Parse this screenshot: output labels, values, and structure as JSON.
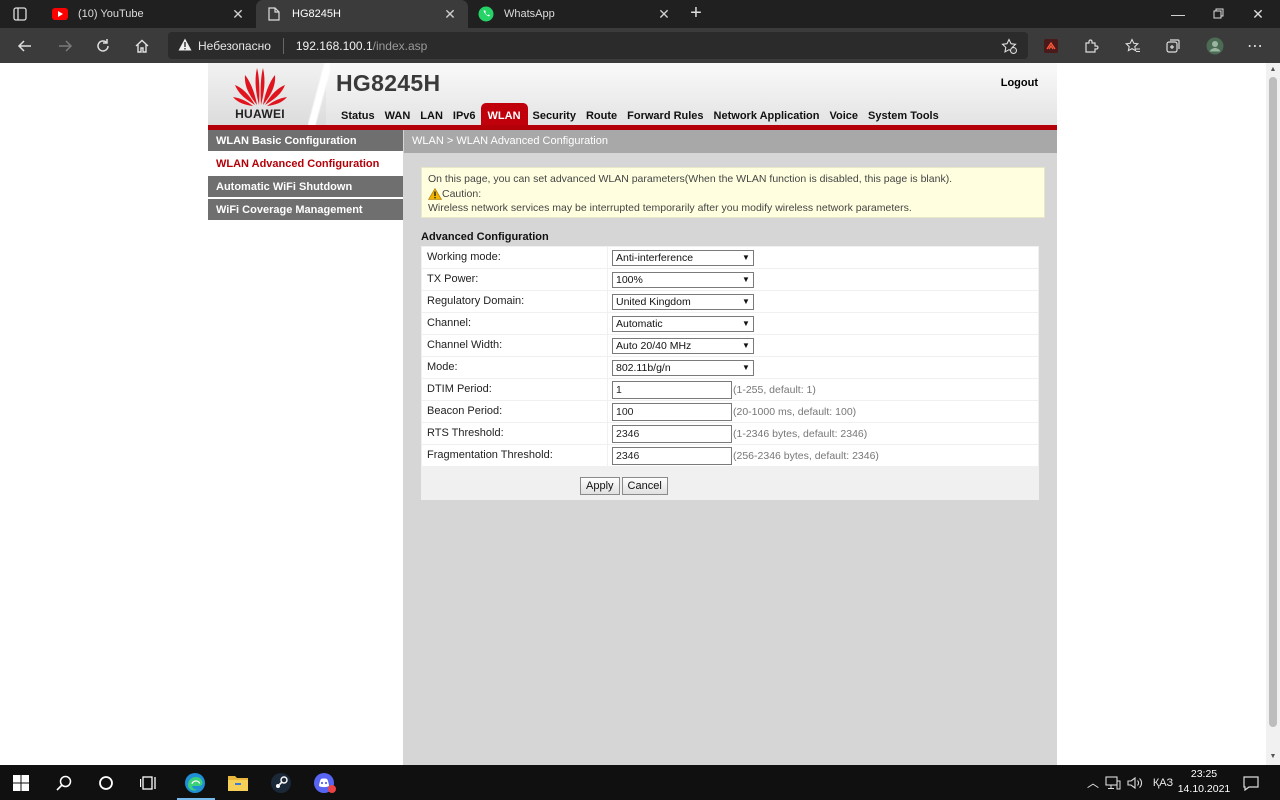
{
  "browser": {
    "tabs": [
      {
        "title": "(10) YouTube",
        "icon": "youtube-icon",
        "active": false
      },
      {
        "title": "HG8245H",
        "icon": "page-icon",
        "active": true
      },
      {
        "title": "WhatsApp",
        "icon": "whatsapp-icon",
        "active": false
      }
    ],
    "security_label": "Небезопасно",
    "url_host": "192.168.100.1",
    "url_path": "/index.asp"
  },
  "router": {
    "brand": "HUAWEI",
    "model": "HG8245H",
    "logout_label": "Logout",
    "menu": [
      "Status",
      "WAN",
      "LAN",
      "IPv6",
      "WLAN",
      "Security",
      "Route",
      "Forward Rules",
      "Network Application",
      "Voice",
      "System Tools"
    ],
    "active_menu": "WLAN",
    "sidebar": [
      {
        "label": "WLAN Basic Configuration",
        "active": false
      },
      {
        "label": "WLAN Advanced Configuration",
        "active": true
      },
      {
        "label": "Automatic WiFi Shutdown",
        "active": false
      },
      {
        "label": "WiFi Coverage Management",
        "active": false
      }
    ],
    "breadcrumb": "WLAN > WLAN Advanced Configuration",
    "notice": {
      "line1": "On this page, you can set advanced WLAN parameters(When the WLAN function is disabled, this page is blank).",
      "caution": "Caution:",
      "line3": "Wireless network services may be interrupted temporarily after you modify wireless network parameters."
    },
    "section_title": "Advanced Configuration",
    "fields": [
      {
        "label": "Working mode:",
        "type": "select",
        "value": "Anti-interference",
        "hint": ""
      },
      {
        "label": "TX Power:",
        "type": "select",
        "value": "100%",
        "hint": ""
      },
      {
        "label": "Regulatory Domain:",
        "type": "select",
        "value": "United Kingdom",
        "hint": ""
      },
      {
        "label": "Channel:",
        "type": "select",
        "value": "Automatic",
        "hint": ""
      },
      {
        "label": "Channel Width:",
        "type": "select",
        "value": "Auto 20/40 MHz",
        "hint": ""
      },
      {
        "label": "Mode:",
        "type": "select",
        "value": "802.11b/g/n",
        "hint": ""
      },
      {
        "label": "DTIM Period:",
        "type": "input",
        "value": "1",
        "hint": "(1-255, default: 1)"
      },
      {
        "label": "Beacon Period:",
        "type": "input",
        "value": "100",
        "hint": "(20-1000 ms, default: 100)"
      },
      {
        "label": "RTS Threshold:",
        "type": "input",
        "value": "2346",
        "hint": "(1-2346 bytes, default: 2346)"
      },
      {
        "label": "Fragmentation Threshold:",
        "type": "input",
        "value": "2346",
        "hint": "(256-2346 bytes, default: 2346)"
      }
    ],
    "apply_label": "Apply",
    "cancel_label": "Cancel"
  },
  "taskbar": {
    "lang": "ҚАЗ",
    "time": "23:25",
    "date": "14.10.2021"
  },
  "colors": {
    "huawei_red": "#c0000a",
    "sidebar_gray": "#6f6f6f",
    "notice_bg": "#ffffe0"
  }
}
